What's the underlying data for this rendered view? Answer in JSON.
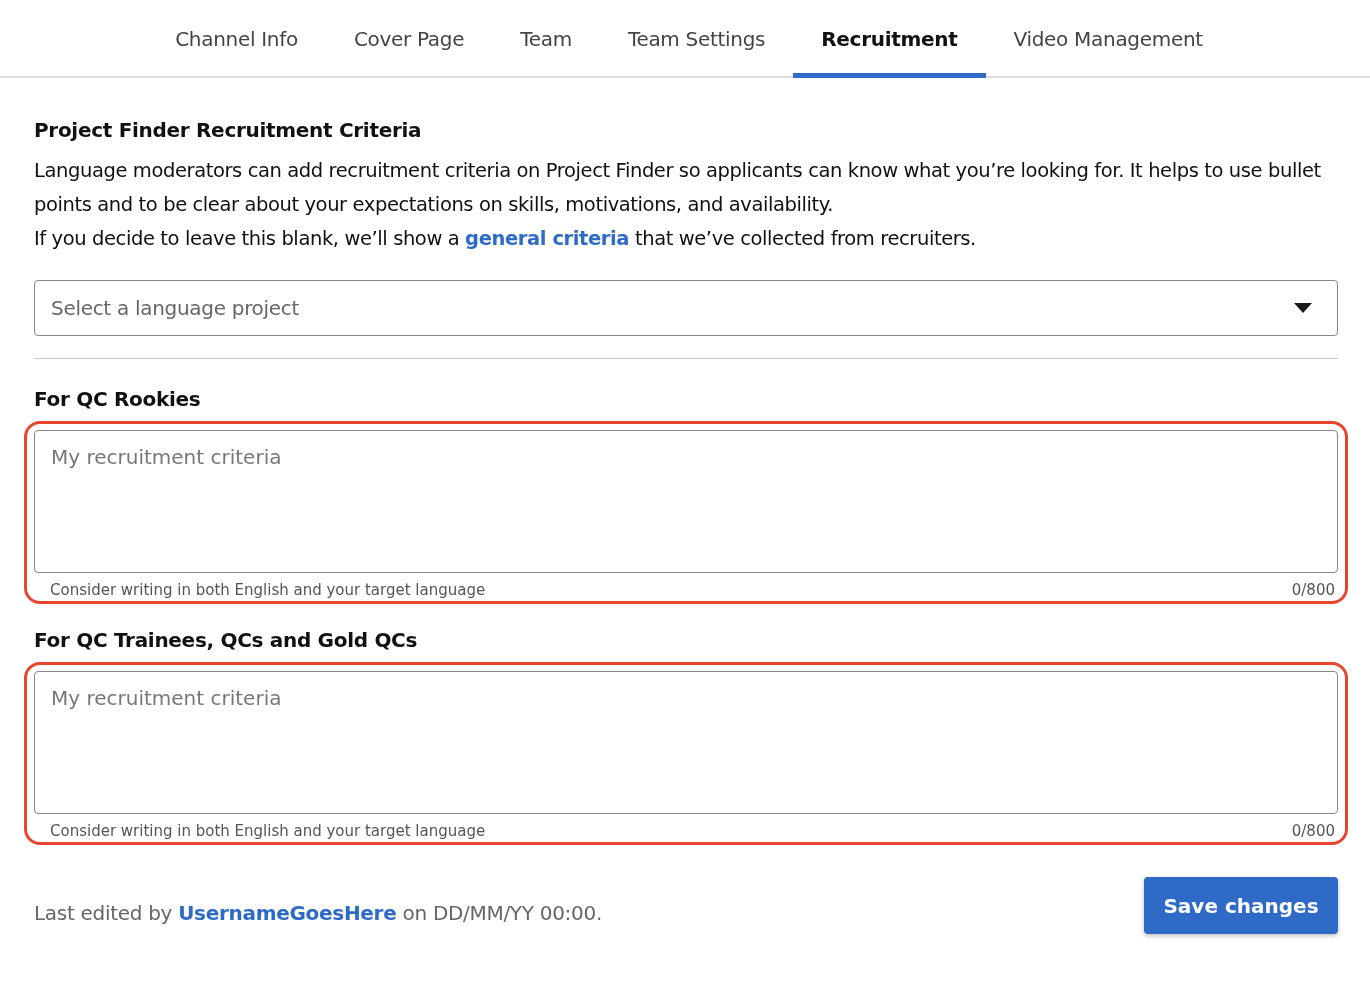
{
  "tabs": [
    {
      "label": "Channel Info",
      "selected": false
    },
    {
      "label": "Cover Page",
      "selected": false
    },
    {
      "label": "Team",
      "selected": false
    },
    {
      "label": "Team Settings",
      "selected": false
    },
    {
      "label": "Recruitment",
      "selected": true
    },
    {
      "label": "Video Management",
      "selected": false
    }
  ],
  "section": {
    "title": "Project Finder Recruitment Criteria",
    "description": "Language moderators can add recruitment criteria on Project Finder so applicants can know what you’re looking for. It helps to use bullet points and to be clear about your expectations on skills, motivations, and availability.",
    "note_before": "If you decide to leave this blank, we’ll show a",
    "note_link": "general criteria",
    "note_after": "that we’ve collected from recruiters."
  },
  "dropdown": {
    "placeholder": "Select a language project"
  },
  "criteria": [
    {
      "title": "For QC Rookies",
      "placeholder": "My recruitment criteria",
      "hint": "Consider writing in both English and your target language",
      "count": "0/800",
      "highlighted": true
    },
    {
      "title": "For QC Trainees, QCs and Gold QCs",
      "placeholder": "My recruitment criteria",
      "hint": "Consider writing in both English and your target language",
      "count": "0/800",
      "highlighted": true
    }
  ],
  "footer": {
    "before": "Last edited by",
    "user": "UsernameGoesHere",
    "after": "on DD/MM/YY 00:00.",
    "button": "Save changes"
  }
}
